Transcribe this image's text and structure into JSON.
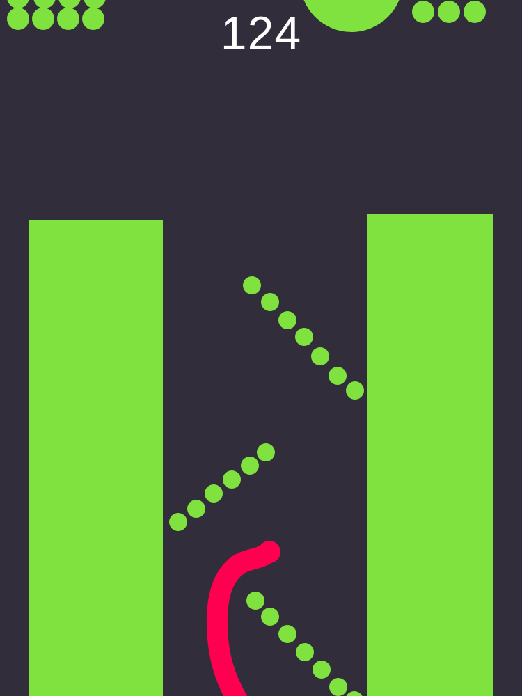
{
  "score": "124",
  "colors": {
    "background": "#322d3a",
    "obstacle": "#7fe23e",
    "pellet": "#7fe23e",
    "snake": "#ff0050",
    "score_text": "#ffffff"
  },
  "icons": {
    "snake": "snake-player-icon",
    "pellet": "green-pellet-icon"
  }
}
